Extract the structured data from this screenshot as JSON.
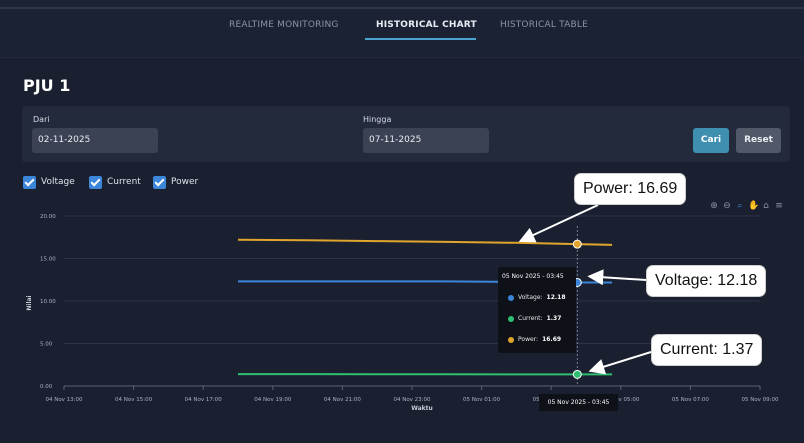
{
  "nav": {
    "tabs": [
      {
        "label": "REALTIME MONITORING"
      },
      {
        "label": "HISTORICAL CHART"
      },
      {
        "label": "HISTORICAL TABLE"
      }
    ],
    "active_tab": "HISTORICAL CHART"
  },
  "page": {
    "title": "PJU 1"
  },
  "filter": {
    "from_label": "Dari",
    "from_value": "02-11-2025",
    "to_label": "Hingga",
    "to_value": "07-11-2025",
    "search_button": "Cari",
    "reset_button": "Reset"
  },
  "toggles": [
    {
      "label": "Voltage",
      "checked": true
    },
    {
      "label": "Current",
      "checked": true
    },
    {
      "label": "Power",
      "checked": true
    }
  ],
  "toolbar_icons": [
    "zoom-in-icon",
    "zoom-out-icon",
    "zoom-select-icon",
    "pan-hand-icon",
    "home-icon",
    "menu-icon"
  ],
  "callouts": {
    "power": "Power: 16.69",
    "voltage": "Voltage: 12.18",
    "current": "Current: 1.37"
  },
  "tooltip": {
    "header": "05 Nov 2025 - 03:45",
    "rows": [
      {
        "name": "Voltage:",
        "value": "12.18",
        "color": "#3b86d9"
      },
      {
        "name": "Current:",
        "value": "1.37",
        "color": "#2fbf71"
      },
      {
        "name": "Power:",
        "value": "16.69",
        "color": "#e0a52c"
      }
    ]
  },
  "x_tooltip": "05 Nov 2025 - 03:45",
  "chart_data": {
    "type": "line",
    "xlabel": "Waktu",
    "ylabel": "Nilai",
    "ylim": [
      0,
      20
    ],
    "yticks": [
      "0.00",
      "5.00",
      "10.00",
      "15.00",
      "20.00"
    ],
    "xticks": [
      "04 Nov 13:00",
      "04 Nov 15:00",
      "04 Nov 17:00",
      "04 Nov 19:00",
      "04 Nov 21:00",
      "04 Nov 23:00",
      "05 Nov 01:00",
      "05 Nov 03:00",
      "05 Nov 05:00",
      "05 Nov 07:00",
      "05 Nov 09:00"
    ],
    "x_hours": [
      13,
      15,
      17,
      19,
      21,
      23,
      25,
      27,
      29,
      31,
      33
    ],
    "grid": true,
    "series": [
      {
        "name": "Voltage",
        "color": "#3b86d9",
        "x": [
          18.0,
          20.0,
          22.0,
          24.0,
          26.0,
          27.75,
          28.75
        ],
        "y": [
          12.3,
          12.3,
          12.3,
          12.3,
          12.25,
          12.18,
          12.18
        ]
      },
      {
        "name": "Current",
        "color": "#2fbf71",
        "x": [
          18.0,
          20.0,
          22.0,
          24.0,
          26.0,
          27.75,
          28.75
        ],
        "y": [
          1.4,
          1.4,
          1.39,
          1.38,
          1.37,
          1.37,
          1.37
        ]
      },
      {
        "name": "Power",
        "color": "#e0a52c",
        "x": [
          18.0,
          20.0,
          22.0,
          24.0,
          26.0,
          27.75,
          28.75
        ],
        "y": [
          17.2,
          17.15,
          17.05,
          16.95,
          16.85,
          16.69,
          16.6
        ]
      }
    ],
    "highlight": {
      "x": 27.75,
      "points": {
        "Voltage": 12.18,
        "Current": 1.37,
        "Power": 16.69
      }
    }
  }
}
